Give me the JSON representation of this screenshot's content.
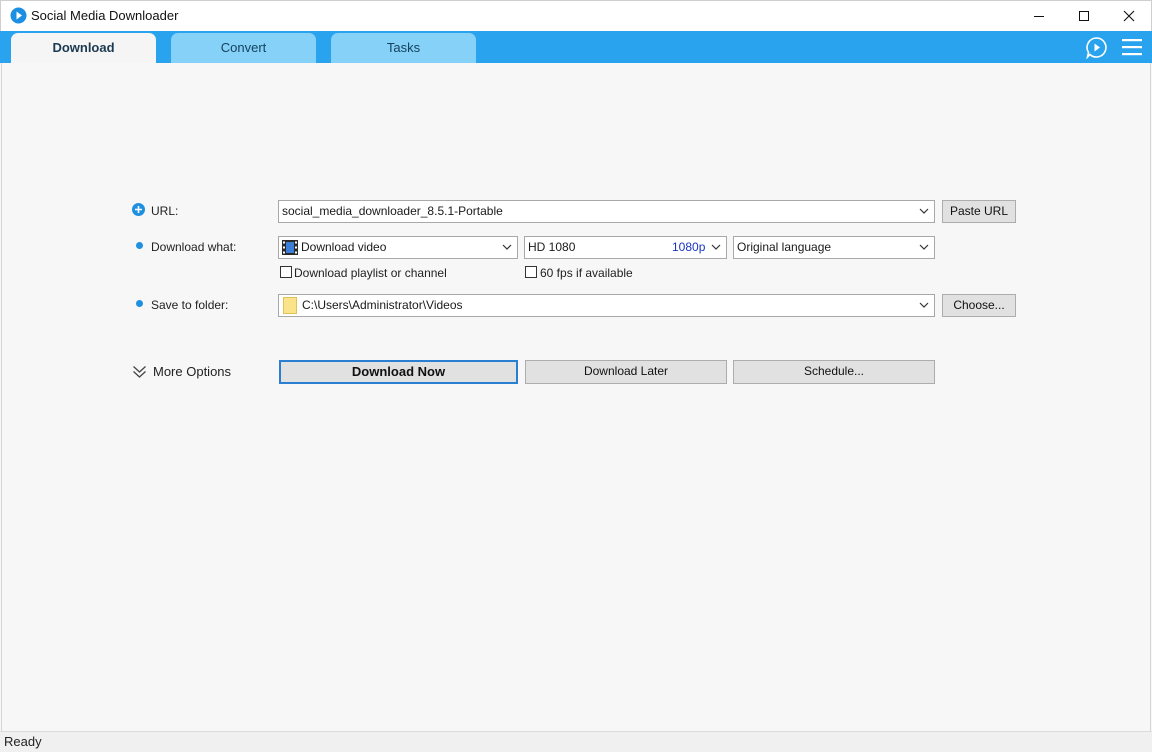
{
  "window": {
    "title": "Social Media Downloader"
  },
  "tabs": [
    {
      "label": "Download",
      "active": true
    },
    {
      "label": "Convert",
      "active": false
    },
    {
      "label": "Tasks",
      "active": false
    }
  ],
  "form": {
    "url_label": "URL:",
    "url_value": "social_media_downloader_8.5.1-Portable",
    "paste_url_button": "Paste URL",
    "download_what_label": "Download what:",
    "download_type_value": "Download video",
    "quality_value": "HD 1080",
    "quality_badge": "1080p",
    "language_value": "Original language",
    "playlist_checkbox_label": "Download playlist or channel",
    "playlist_checked": false,
    "fps_checkbox_label": "60 fps if available",
    "fps_checked": false,
    "save_folder_label": "Save to folder:",
    "folder_value": "C:\\Users\\Administrator\\Videos",
    "choose_button": "Choose..."
  },
  "actions": {
    "more_options": "More Options",
    "download_now": "Download Now",
    "download_later": "Download Later",
    "schedule": "Schedule..."
  },
  "status": {
    "text": "Ready"
  },
  "colors": {
    "accent": "#2aa3ef",
    "tab_inactive": "#86d1f7",
    "quality_badge": "#1a35c0"
  }
}
